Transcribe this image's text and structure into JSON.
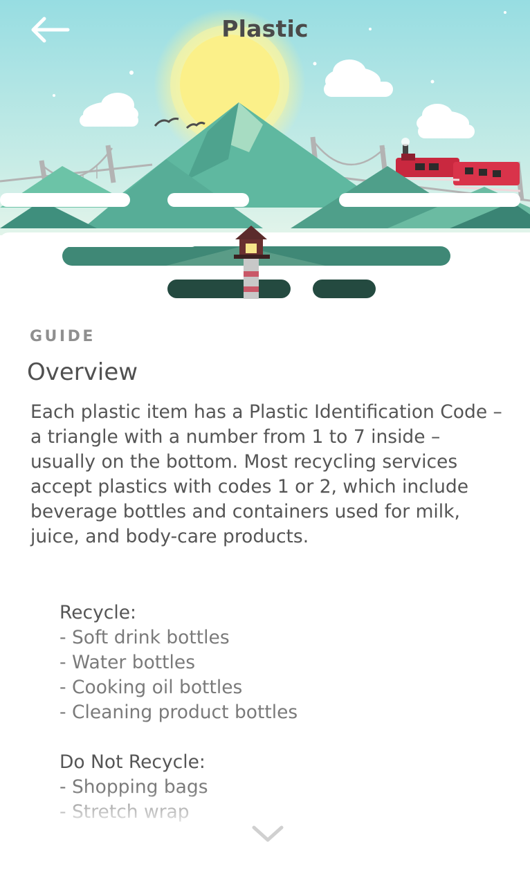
{
  "header": {
    "title": "Plastic",
    "back_icon": "arrow-left-icon"
  },
  "guide": {
    "label": "GUIDE",
    "title": "Overview",
    "body": "Each plastic item has a Plastic Identification Code – a triangle with a number from 1 to 7 inside – usually on the bottom. Most recycling services accept plastics with codes 1 or 2, which include beverage bottles and containers used for milk, juice, and body-care products."
  },
  "recycle": {
    "heading": "Recycle:",
    "items": [
      "- Soft drink bottles",
      "- Water bottles",
      "- Cooking oil bottles",
      "- Cleaning product bottles"
    ]
  },
  "do_not_recycle": {
    "heading": "Do Not Recycle:",
    "items": [
      "- Shopping bags",
      "- Stretch wrap"
    ]
  },
  "scroll": {
    "icon": "chevron-down-icon"
  },
  "colors": {
    "sky_top": "#9fe0e2",
    "sky_bottom": "#d9f1e8",
    "sun": "#fbf089",
    "mountain": "#5ab59f",
    "train": "#c9283f",
    "text_primary": "#555555",
    "text_secondary": "#7a7a7a"
  }
}
